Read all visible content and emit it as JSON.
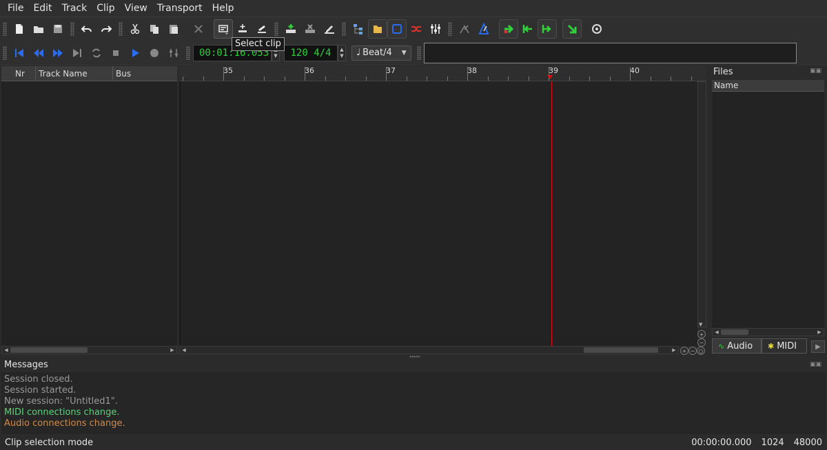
{
  "menu": [
    "File",
    "Edit",
    "Track",
    "Clip",
    "View",
    "Transport",
    "Help"
  ],
  "tooltip": "Select clip",
  "transport": {
    "time": "00:01:16.053",
    "tempo": "120 4/4",
    "snap": "Beat/4"
  },
  "tracks": {
    "headers": [
      "Nr",
      "Track Name",
      "Bus"
    ]
  },
  "ruler": {
    "labels": [
      "35",
      "36",
      "37",
      "38",
      "39",
      "40"
    ]
  },
  "files": {
    "title": "Files",
    "column": "Name",
    "tabs": [
      "Audio",
      "MIDI"
    ]
  },
  "messages": {
    "title": "Messages",
    "lines": [
      {
        "text": "Session closed.",
        "color": "#9a9a9a"
      },
      {
        "text": "Session started.",
        "color": "#9a9a9a"
      },
      {
        "text": "New session: \"Untitled1\".",
        "color": "#9a9a9a"
      },
      {
        "text": "MIDI connections change.",
        "color": "#5fd07a"
      },
      {
        "text": "Audio connections change.",
        "color": "#d28a4a"
      }
    ]
  },
  "status": {
    "mode": "Clip selection mode",
    "position": "00:00:00.000",
    "buffer": "1024",
    "sample_rate": "48000"
  },
  "colors": {
    "accent_green": "#2fd23a",
    "playhead_red": "#e01010",
    "transport_blue": "#2a6cf0"
  }
}
